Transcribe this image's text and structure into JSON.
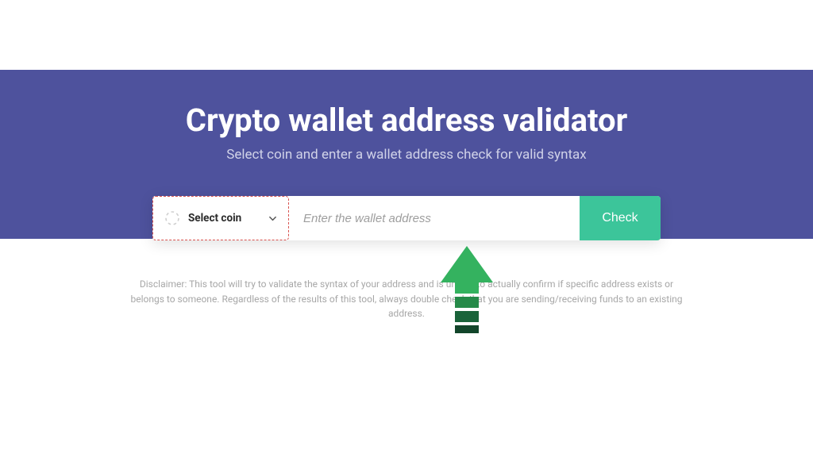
{
  "hero": {
    "title": "Crypto wallet address validator",
    "subtitle": "Select coin and enter a wallet address check for valid syntax"
  },
  "form": {
    "coin_select_label": "Select coin",
    "address_placeholder": "Enter the wallet address",
    "check_label": "Check"
  },
  "disclaimer": "Disclaimer: This tool will try to validate the syntax of your address and is unable to actually confirm if specific address exists or belongs to someone. Regardless of the results of this tool, always double check that you are sending/receiving funds to an existing address.",
  "colors": {
    "hero_bg": "#4e529d",
    "check_btn": "#3cc59a",
    "highlight_border": "#d9534f",
    "arrow": "#34b25f"
  }
}
